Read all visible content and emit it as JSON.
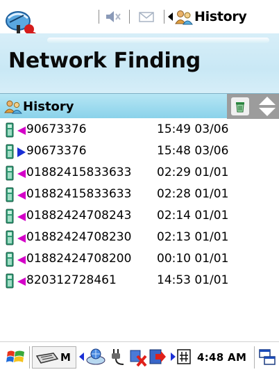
{
  "status_bar": {
    "title": "History",
    "icons": [
      "app-logo-icon",
      "speaker-icon",
      "mail-icon",
      "left-arrow-icon",
      "people-icon"
    ]
  },
  "page": {
    "title": "Network Finding"
  },
  "list_header": {
    "label": "History",
    "icons": [
      "people-icon",
      "trash-icon",
      "sort-up-down-icon"
    ]
  },
  "calls": [
    {
      "number": "90673376",
      "time": "15:49 03/06",
      "direction": "incoming"
    },
    {
      "number": "90673376",
      "time": "15:48 03/06",
      "direction": "outgoing"
    },
    {
      "number": "01882415833633",
      "time": "02:29 01/01",
      "direction": "incoming"
    },
    {
      "number": "01882415833633",
      "time": "02:28 01/01",
      "direction": "incoming"
    },
    {
      "number": "01882424708243",
      "time": "02:14 01/01",
      "direction": "incoming"
    },
    {
      "number": "01882424708230",
      "time": "02:13 01/01",
      "direction": "incoming"
    },
    {
      "number": "01882424708200",
      "time": "00:10 01/01",
      "direction": "incoming"
    },
    {
      "number": "820312728461",
      "time": "14:53 01/01",
      "direction": "incoming"
    }
  ],
  "taskbar": {
    "input_mode": "M",
    "clock": "4:48 AM",
    "icons": [
      "start-flag-icon",
      "keyboard-icon",
      "network-icon",
      "power-plug-icon",
      "sync-error-icon",
      "exit-icon",
      "keypad-icon",
      "windows-switch-icon"
    ]
  },
  "colors": {
    "banner": "#c9e8f5",
    "list_header": "#8ad2ea",
    "incoming_arrow": "#d400c8",
    "outgoing_arrow": "#1a2fd6"
  }
}
